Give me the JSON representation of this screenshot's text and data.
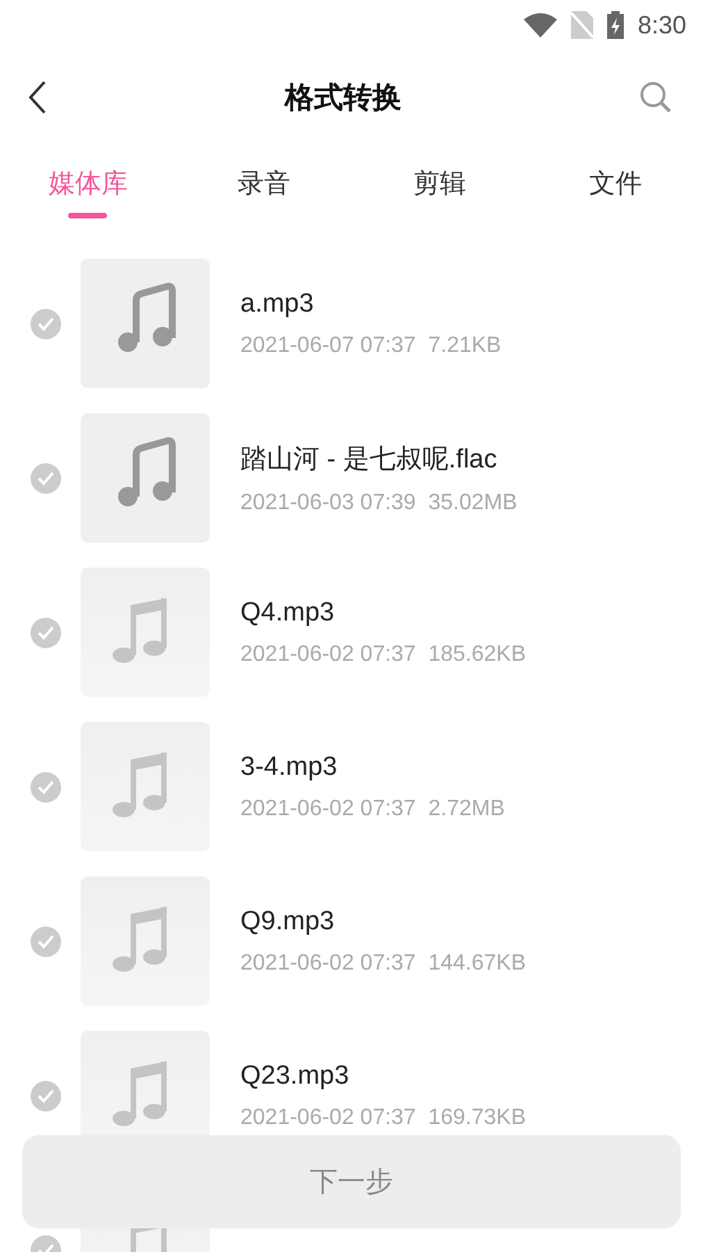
{
  "status_bar": {
    "time": "8:30"
  },
  "header": {
    "title": "格式转换"
  },
  "tabs": [
    {
      "label": "媒体库",
      "selected": true
    },
    {
      "label": "录音",
      "selected": false
    },
    {
      "label": "剪辑",
      "selected": false
    },
    {
      "label": "文件",
      "selected": false
    }
  ],
  "files": [
    {
      "name": "a.mp3",
      "info": "2021-06-07 07:37  7.21KB",
      "kind": "note",
      "selected": false
    },
    {
      "name": "踏山河 - 是七叔呢.flac",
      "info": "2021-06-03 07:39  35.02MB",
      "kind": "note",
      "selected": false
    },
    {
      "name": "Q4.mp3",
      "info": "2021-06-02 07:37  185.62KB",
      "kind": "cover",
      "selected": false
    },
    {
      "name": "3-4.mp3",
      "info": "2021-06-02 07:37  2.72MB",
      "kind": "cover",
      "selected": false
    },
    {
      "name": "Q9.mp3",
      "info": "2021-06-02 07:37  144.67KB",
      "kind": "cover",
      "selected": false
    },
    {
      "name": "Q23.mp3",
      "info": "2021-06-02 07:37  169.73KB",
      "kind": "cover",
      "selected": false
    },
    {
      "kind": "cover",
      "selected": false
    }
  ],
  "next_button": {
    "label": "下一步",
    "disabled": true
  }
}
